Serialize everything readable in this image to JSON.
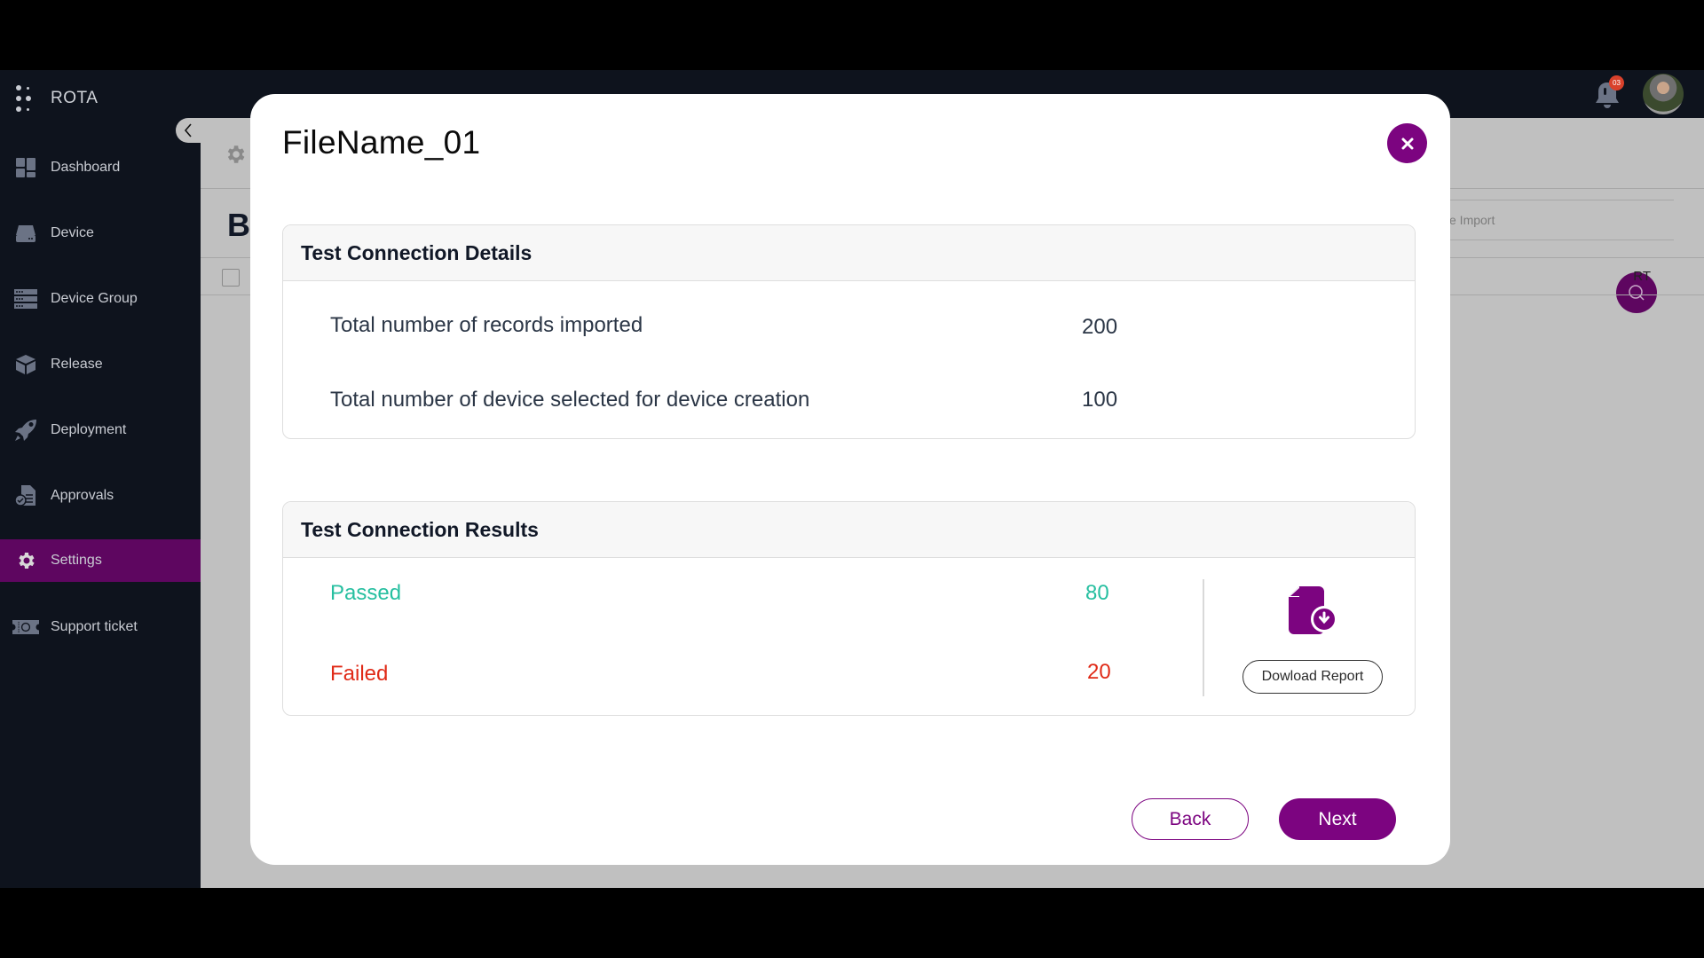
{
  "app": {
    "brand": "ROTA",
    "notifications_count": "03",
    "colors": {
      "accent": "#7c0480",
      "sidebar_bg": "#0e131d",
      "sidebar_active": "#5e0660",
      "passed": "#26bfa0",
      "failed": "#e02a17",
      "badge": "#d9412b"
    }
  },
  "sidebar": {
    "items": [
      {
        "label": "Dashboard",
        "icon": "dashboard-icon",
        "active": false
      },
      {
        "label": "Device",
        "icon": "device-icon",
        "active": false
      },
      {
        "label": "Device Group",
        "icon": "device-group-icon",
        "active": false
      },
      {
        "label": "Release",
        "icon": "release-box-icon",
        "active": false
      },
      {
        "label": "Deployment",
        "icon": "rocket-icon",
        "active": false
      },
      {
        "label": "Approvals",
        "icon": "approvals-icon",
        "active": false
      },
      {
        "label": "Settings",
        "icon": "gear-icon",
        "active": true
      },
      {
        "label": "Support ticket",
        "icon": "ticket-icon",
        "active": false
      }
    ]
  },
  "background_page": {
    "title_fragment": "B",
    "search_placeholder_fragment": "ce Import",
    "column_fragment": "RT"
  },
  "modal": {
    "title": "FileName_01",
    "details": {
      "heading": "Test Connection Details",
      "rows": [
        {
          "label": "Total number of records imported",
          "value": "200"
        },
        {
          "label": "Total number of device selected for device creation",
          "value": "100"
        }
      ]
    },
    "results": {
      "heading": "Test Connection Results",
      "passed_label": "Passed",
      "passed_value": "80",
      "failed_label": "Failed",
      "failed_value": "20",
      "download_label": "Dowload Report"
    },
    "back_label": "Back",
    "next_label": "Next"
  }
}
